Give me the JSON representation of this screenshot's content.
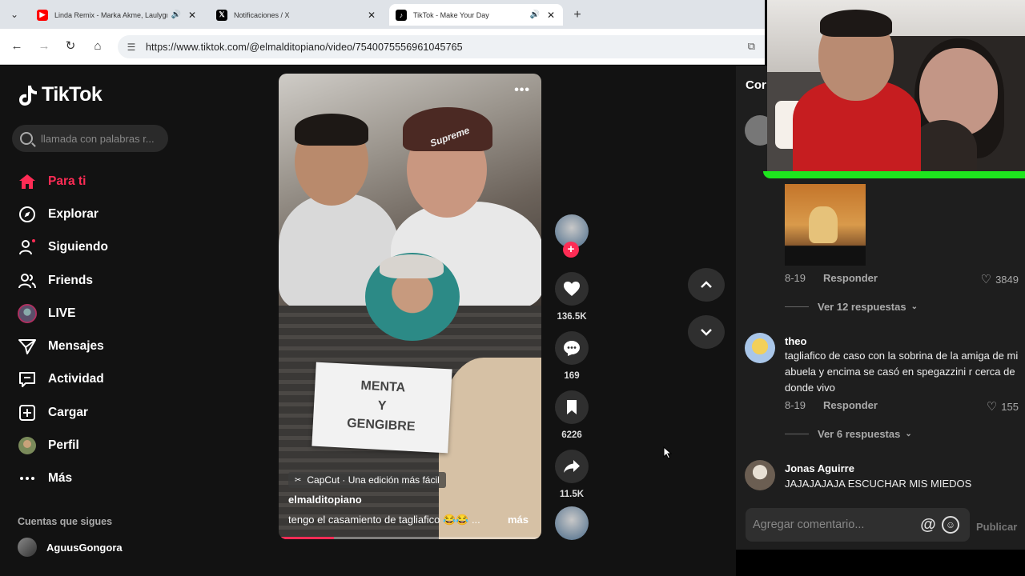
{
  "browser": {
    "tabs": [
      {
        "label": "Linda Remix - Marka Akme, Laulygra",
        "favicon": "youtube-icon",
        "audio": true,
        "active": false
      },
      {
        "label": "Notificaciones / X",
        "favicon": "x-icon",
        "audio": false,
        "active": false
      },
      {
        "label": "TikTok - Make Your Day",
        "favicon": "tiktok-icon",
        "audio": true,
        "active": true
      }
    ],
    "url": "https://www.tiktok.com/@elmalditopiano/video/7540075556961045765"
  },
  "sidebar": {
    "logo": "TikTok",
    "search_placeholder": "llamada con palabras r...",
    "nav": [
      {
        "label": "Para ti",
        "icon": "home-icon",
        "active": true
      },
      {
        "label": "Explorar",
        "icon": "compass-icon",
        "active": false
      },
      {
        "label": "Siguiendo",
        "icon": "following-icon",
        "active": false
      },
      {
        "label": "Friends",
        "icon": "friends-icon",
        "active": false
      },
      {
        "label": "LIVE",
        "icon": "live-icon",
        "active": false
      },
      {
        "label": "Mensajes",
        "icon": "messages-icon",
        "active": false
      },
      {
        "label": "Actividad",
        "icon": "activity-icon",
        "active": false
      },
      {
        "label": "Cargar",
        "icon": "upload-icon",
        "active": false
      },
      {
        "label": "Perfil",
        "icon": "profile-icon",
        "active": false
      },
      {
        "label": "Más",
        "icon": "more-icon",
        "active": false
      }
    ],
    "following_title": "Cuentas que sigues",
    "following": [
      {
        "name": "AguusGongora"
      }
    ]
  },
  "video": {
    "sign_lines": [
      "MENTA",
      "Y",
      "GENGIBRE"
    ],
    "hat_text": "Supreme",
    "capcut": "CapCut · Una edición más fácil",
    "author": "elmalditopiano",
    "caption": "tengo el casamiento de tagliafico 😂😂 ...",
    "more": "más",
    "progress_fraction": 0.21,
    "likes": "136.5K",
    "comments": "169",
    "saves": "6226",
    "shares": "11.5K"
  },
  "comments": {
    "title": "Cor",
    "items": [
      {
        "date": "8-19",
        "reply": "Responder",
        "likes": "3849",
        "view_replies": "Ver 12 respuestas"
      },
      {
        "name": "theo",
        "text": "tagliafico de caso con la sobrina de la amiga de mi abuela y encima se casó en spegazzini r cerca de donde vivo",
        "date": "8-19",
        "reply": "Responder",
        "likes": "155",
        "view_replies": "Ver 6 respuestas"
      },
      {
        "name": "Jonas Aguirre",
        "text": "JAJAJAJAJA ESCUCHAR MIS MIEDOS"
      }
    ],
    "input_placeholder": "Agregar comentario...",
    "mention_icon": "@",
    "publish": "Publicar"
  },
  "colors": {
    "accent": "#fe2c55",
    "webcam_border": "#1ee61e"
  }
}
